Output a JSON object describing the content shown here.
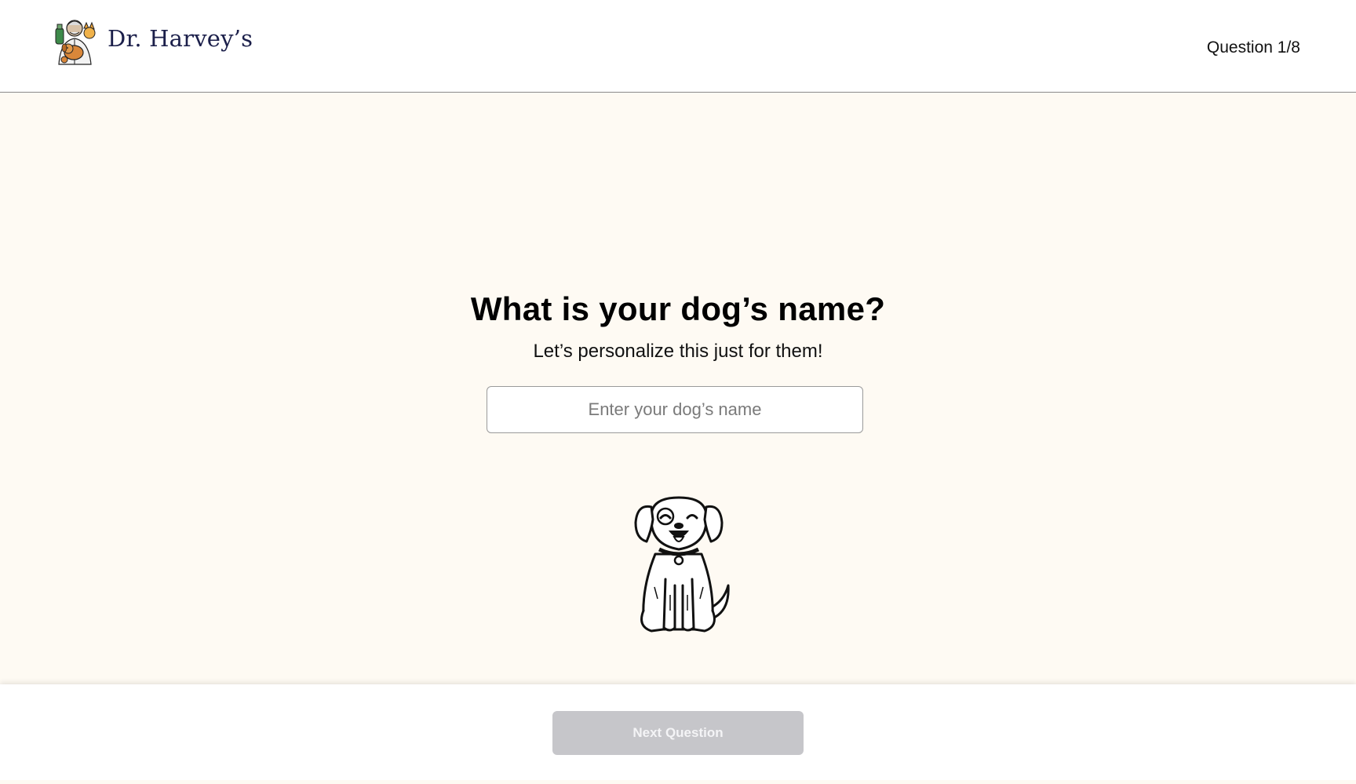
{
  "header": {
    "brand_name": "Dr. Harvey’s",
    "progress_label": "Question 1/8"
  },
  "main": {
    "question": "What is your dog’s name?",
    "subtitle": "Let’s personalize this just for them!",
    "name_input": {
      "value": "",
      "placeholder": "Enter your dog’s name"
    },
    "illustration_icon": "smiling-dog-icon"
  },
  "footer": {
    "next_button_label": "Next Question",
    "next_button_enabled": false
  },
  "colors": {
    "page_background": "#fefaf3",
    "brand_text": "#1b1f4a",
    "button_disabled": "#c6c6ca",
    "button_text": "#f4f4f6"
  }
}
